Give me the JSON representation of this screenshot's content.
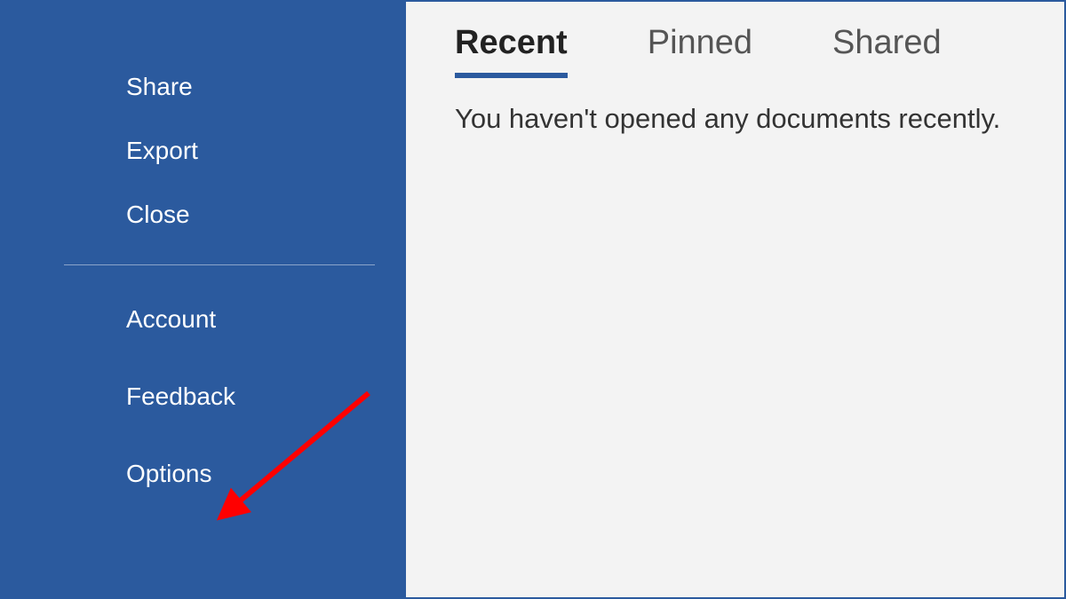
{
  "sidebar": {
    "items": [
      {
        "label": "Share"
      },
      {
        "label": "Export"
      },
      {
        "label": "Close"
      },
      {
        "label": "Account"
      },
      {
        "label": "Feedback"
      },
      {
        "label": "Options"
      }
    ]
  },
  "tabs": [
    {
      "label": "Recent",
      "active": true
    },
    {
      "label": "Pinned",
      "active": false
    },
    {
      "label": "Shared",
      "active": false
    }
  ],
  "empty_message": "You haven't opened any documents recently.",
  "colors": {
    "sidebar_bg": "#2b5a9e",
    "main_bg": "#f3f3f3",
    "accent": "#2b5a9e",
    "arrow": "#ff0000"
  }
}
